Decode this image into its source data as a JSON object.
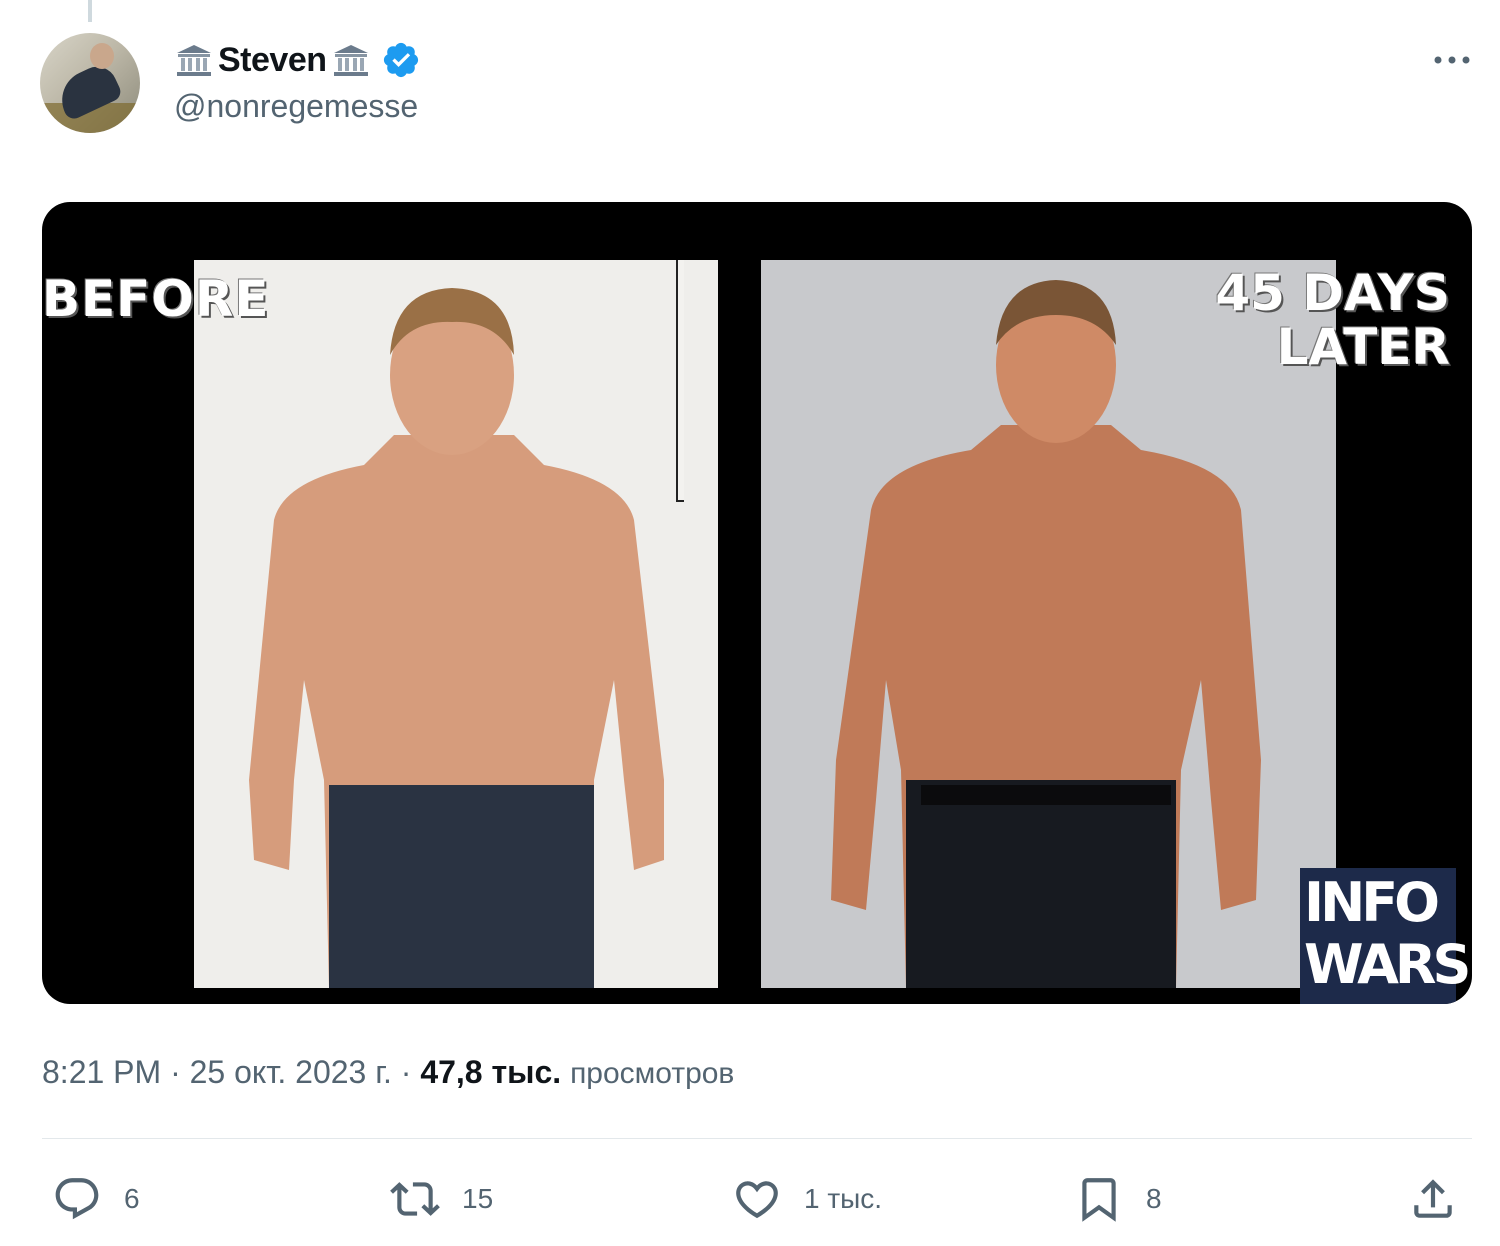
{
  "author": {
    "display_name": "Steven",
    "handle": "@nonregemesse",
    "verified": true,
    "name_decoration_icon": "classical-building-icon"
  },
  "media": {
    "before_label": "BEFORE",
    "after_label_line1": "45 DAYS",
    "after_label_line2": "LATER",
    "logo_line1": "INFO",
    "logo_line2": "WARS"
  },
  "meta": {
    "time": "8:21 PM",
    "separator": " · ",
    "date": "25 окт. 2023 г.",
    "views_count": "47,8 тыс.",
    "views_label": "просмотров"
  },
  "actions": {
    "reply_count": "6",
    "repost_count": "15",
    "like_count": "1 тыс.",
    "bookmark_count": "8"
  },
  "colors": {
    "text_primary": "#0f1419",
    "text_secondary": "#536471",
    "verified_blue": "#1d9bf0",
    "divider": "#e3e8eb"
  }
}
